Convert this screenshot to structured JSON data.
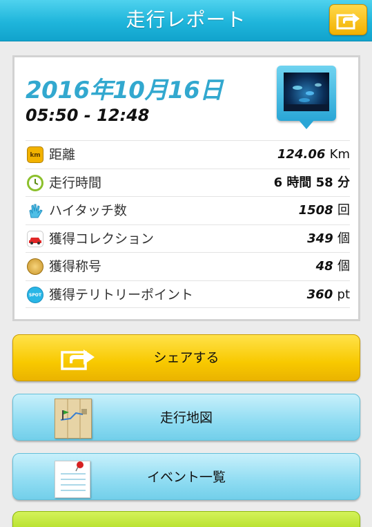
{
  "header": {
    "title": "走行レポート"
  },
  "report": {
    "date": "2016年10月16日",
    "time_range": "05:50 - 12:48",
    "rows": [
      {
        "icon": "km-icon",
        "icon_text": "km",
        "label": "距離",
        "value": "124.06",
        "unit": "Km"
      },
      {
        "icon": "clock-icon",
        "label": "走行時間",
        "value": "6",
        "unit": "時間",
        "value2": "58",
        "unit2": "分"
      },
      {
        "icon": "high-five-hand-icon",
        "label": "ハイタッチ数",
        "value": "1508",
        "unit": "回"
      },
      {
        "icon": "car-icon",
        "label": "獲得コレクション",
        "value": "349",
        "unit": "個"
      },
      {
        "icon": "medal-icon",
        "label": "獲得称号",
        "value": "48",
        "unit": "個"
      },
      {
        "icon": "spot-icon",
        "icon_text": "SPOT",
        "label": "獲得テリトリーポイント",
        "value": "360",
        "unit": "pt"
      }
    ]
  },
  "buttons": {
    "share": "シェアする",
    "map": "走行地図",
    "events": "イベント一覧"
  },
  "colors": {
    "header": "#1fb5db",
    "date": "#32a8cf",
    "share_button": "#f8c900",
    "nav_button": "#8fdcf2",
    "green_button": "#b5e020"
  }
}
